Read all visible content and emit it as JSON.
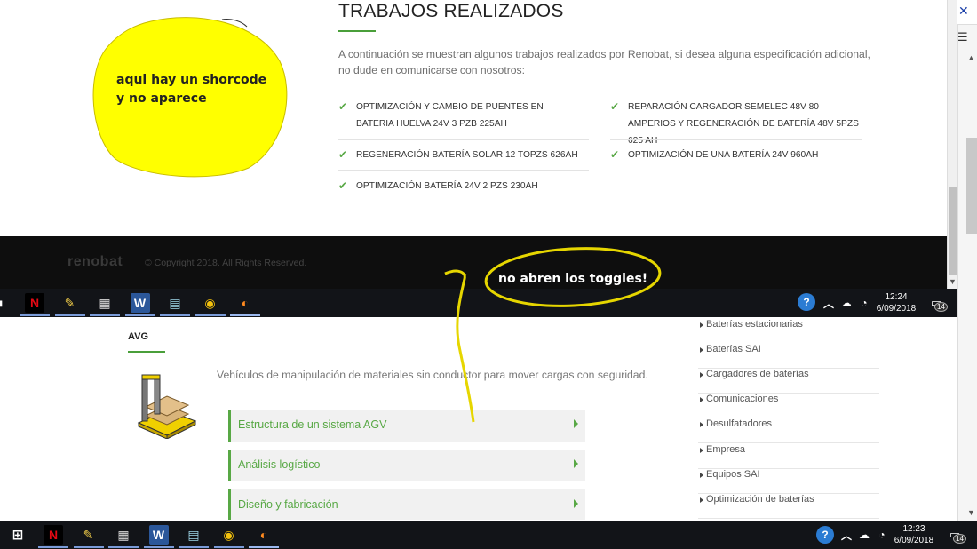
{
  "works": {
    "title": "TRABAJOS REALIZADOS",
    "intro": "A continuación se muestran algunos trabajos realizados por Renobat, si desea alguna especificación adicional, no dude en comunicarse con nosotros:",
    "left": [
      "OPTIMIZACIÓN Y CAMBIO DE PUENTES EN BATERIA HUELVA 24V 3 PZB 225AH",
      "REGENERACIÓN BATERÍA SOLAR 12 TOPZS 626AH",
      "OPTIMIZACIÓN BATERÍA 24V 2 PZS 230AH"
    ],
    "right": [
      "REPARACIÓN CARGADOR SEMELEC 48V 80 AMPERIOS Y REGENERACIÓN DE BATERÍA 48V 5PZS 625 AH",
      "OPTIMIZACIÓN DE UNA BATERÍA 24V 960AH"
    ]
  },
  "footer": {
    "logo": "renobat",
    "copyright": "© Copyright 2018. All Rights Reserved."
  },
  "annotations": {
    "shortcode_line1": "aqui hay un shorcode",
    "shortcode_line2": "y no aparece",
    "toggles": "no abren los toggles!"
  },
  "taskbar_top": {
    "time": "12:24",
    "date": "6/09/2018",
    "notif": "14"
  },
  "taskbar_bottom": {
    "time": "12:23",
    "date": "6/09/2018",
    "notif": "14"
  },
  "taskbar_apps": [
    {
      "icon": "netflix-icon",
      "glyph": "N",
      "color": "#e50914",
      "bg": "#000"
    },
    {
      "icon": "paint-icon",
      "glyph": "✎",
      "color": "#f5d04a",
      "bg": "transparent"
    },
    {
      "icon": "calculator-icon",
      "glyph": "▦",
      "color": "#ddd",
      "bg": "transparent"
    },
    {
      "icon": "word-icon",
      "glyph": "W",
      "color": "#fff",
      "bg": "#2b579a"
    },
    {
      "icon": "notes-icon",
      "glyph": "▤",
      "color": "#9fd6e8",
      "bg": "transparent"
    },
    {
      "icon": "chrome-icon",
      "glyph": "◉",
      "color": "#f4c20d",
      "bg": "transparent"
    },
    {
      "icon": "firefox-icon",
      "glyph": "◐",
      "color": "#ff8a1f",
      "bg": "transparent"
    }
  ],
  "avg": {
    "title": "AVG",
    "description": "Vehículos de manipulación de materiales sin conductor para mover cargas con seguridad.",
    "toggles": [
      "Estructura de un sistema AGV",
      "Análisis logístico",
      "Diseño y fabricación"
    ]
  },
  "categories": [
    "Baterías estacionarias",
    "Baterías SAI",
    "Cargadores de baterías",
    "Comunicaciones",
    "Desulfatadores",
    "Empresa",
    "Equipos SAI",
    "Optimización de baterías"
  ],
  "colors": {
    "accent": "#58a845",
    "annotation_yellow": "#ffff00",
    "annotation_stroke": "#e6d600"
  }
}
